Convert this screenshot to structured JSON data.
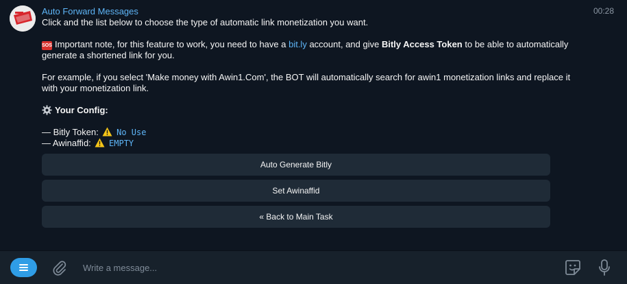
{
  "message": {
    "sender": "Auto Forward Messages",
    "time": "00:28",
    "line1": "Click and the list below to choose the type of automatic link monetization you want.",
    "note_prefix": "Important note, for this feature to work, you need to have a ",
    "note_link": "bit.ly",
    "note_middle": " account, and give ",
    "note_bold": "Bitly Access Token",
    "note_suffix": " to be able to automatically generate a shortened link for you.",
    "example": "For example, if you select 'Make money with Awin1.Com', the BOT will automatically search for awin1 monetization links and replace it with your monetization link.",
    "config_title": "Your Config:",
    "bitly_label": "— Bitly Token: ",
    "bitly_value": "No Use",
    "awin_label": "— Awinaffid: ",
    "awin_value": "EMPTY",
    "sos_badge": "SOS",
    "icons": [
      "gear-icon",
      "warning-icon"
    ]
  },
  "buttons": [
    {
      "label": "Auto Generate Bitly"
    },
    {
      "label": "Set Awinaffid"
    },
    {
      "label": "« Back to Main Task"
    }
  ],
  "composer": {
    "placeholder": "Write a message...",
    "icons": [
      "menu-icon",
      "attach-icon",
      "sticker-icon",
      "microphone-icon"
    ]
  },
  "colors": {
    "background": "#0e1621",
    "accent": "#5eb5f7",
    "button": "#1f2b37",
    "composer": "#17212b",
    "menu_button": "#2f9de6"
  }
}
